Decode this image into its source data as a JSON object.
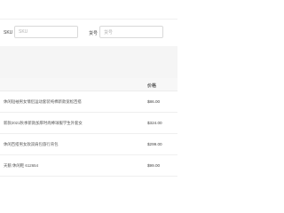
{
  "filters": {
    "sku_label": "SKU",
    "sku_placeholder": "SKU",
    "sku_code_label": "货号",
    "sku_code_placeholder": "货号"
  },
  "table": {
    "price_header": "价格",
    "rows": [
      {
        "name": "休闲短袖男女情侣运动套装纯棉新款宽松百搭",
        "price": "$86.00"
      },
      {
        "name": "新款2021秋季新款加厚时尚棒球服学生外套女",
        "price": "$324.00"
      },
      {
        "name": "休闲百搭男女款双肩包旅行背包",
        "price": "$299.00"
      },
      {
        "name": "天鹅 休闲鞋 612654",
        "price": "$99.00"
      }
    ]
  }
}
